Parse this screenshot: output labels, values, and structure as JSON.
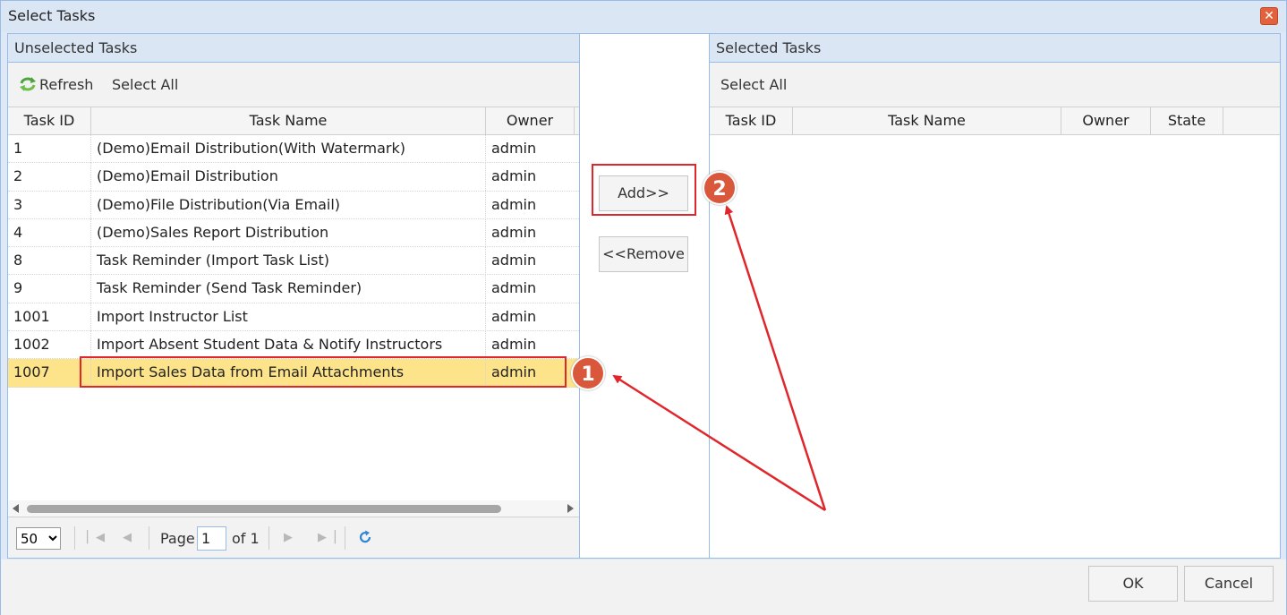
{
  "window": {
    "title": "Select Tasks",
    "close_glyph": "✕"
  },
  "left_panel": {
    "title": "Unselected Tasks",
    "toolbar": {
      "refresh": "Refresh",
      "select_all": "Select All"
    },
    "columns": [
      "Task ID",
      "Task Name",
      "Owner"
    ],
    "rows": [
      {
        "id": "1",
        "name": "(Demo)Email Distribution(With Watermark)",
        "owner": "admin"
      },
      {
        "id": "2",
        "name": "(Demo)Email Distribution",
        "owner": "admin"
      },
      {
        "id": "3",
        "name": "(Demo)File Distribution(Via Email)",
        "owner": "admin"
      },
      {
        "id": "4",
        "name": "(Demo)Sales Report Distribution",
        "owner": "admin"
      },
      {
        "id": "8",
        "name": "Task Reminder (Import Task List)",
        "owner": "admin"
      },
      {
        "id": "9",
        "name": "Task Reminder (Send Task Reminder)",
        "owner": "admin"
      },
      {
        "id": "1001",
        "name": "Import Instructor List",
        "owner": "admin"
      },
      {
        "id": "1002",
        "name": "Import Absent Student Data & Notify Instructors",
        "owner": "admin"
      },
      {
        "id": "1007",
        "name": "Import Sales Data from Email Attachments",
        "owner": "admin"
      }
    ],
    "selected_row_index": 8,
    "pager": {
      "page_size": "50",
      "page_label": "Page",
      "page_value": "1",
      "of_label": "of 1"
    }
  },
  "middle": {
    "add": "Add>>",
    "remove": "<<Remove"
  },
  "right_panel": {
    "title": "Selected Tasks",
    "toolbar": {
      "select_all": "Select All"
    },
    "columns": [
      "Task ID",
      "Task Name",
      "Owner",
      "State"
    ]
  },
  "footer": {
    "ok": "OK",
    "cancel": "Cancel"
  },
  "annotations": {
    "step1": "1",
    "step2": "2",
    "color": "#e0262b",
    "badge_color": "#d9583b"
  },
  "colors": {
    "selected_row": "#fde48b",
    "border": "#99bbe8",
    "header_bg": "#dbe6f5"
  }
}
